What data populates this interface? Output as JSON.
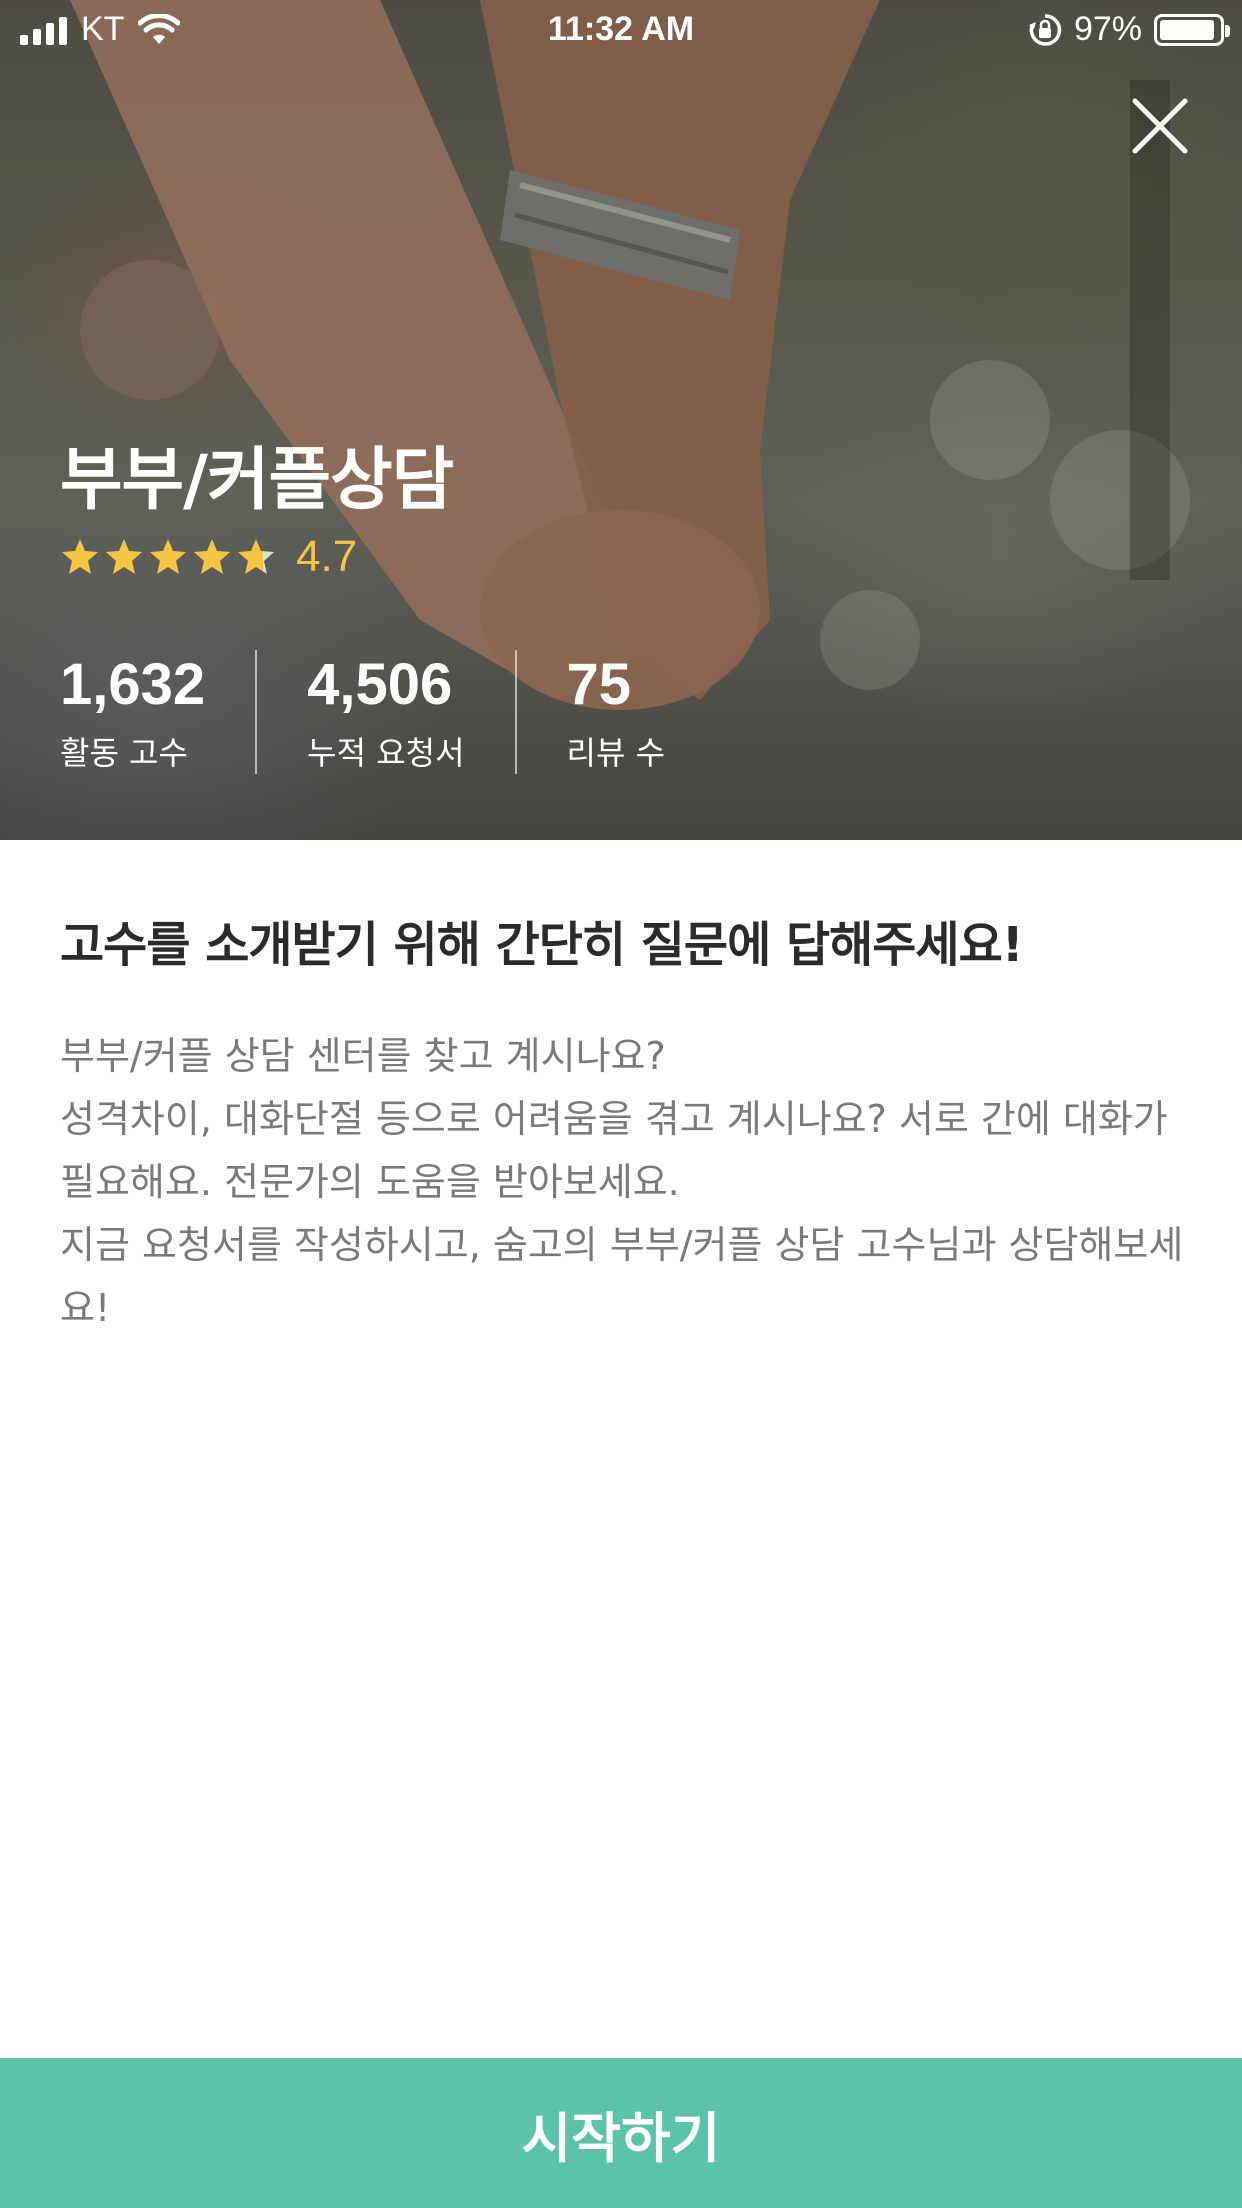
{
  "status_bar": {
    "carrier": "KT",
    "time": "11:32 AM",
    "battery": "97%"
  },
  "hero": {
    "title": "부부/커플상담",
    "rating": "4.7",
    "rating_value": 4.7,
    "stats": [
      {
        "value": "1,632",
        "label": "활동 고수"
      },
      {
        "value": "4,506",
        "label": "누적 요청서"
      },
      {
        "value": "75",
        "label": "리뷰 수"
      }
    ]
  },
  "content": {
    "heading": "고수를 소개받기 위해 간단히 질문에 답해주세요!",
    "lines": [
      "부부/커플 상담 센터를 찾고 계시나요?",
      "성격차이, 대화단절 등으로 어려움을 겪고 계시나요? 서로 간에 대화가 필요해요. 전문가의 도움을 받아보세요.",
      "지금 요청서를 작성하시고, 숨고의 부부/커플 상담 고수님과 상담해보세요!"
    ]
  },
  "cta": {
    "label": "시작하기"
  },
  "colors": {
    "accent": "#5bc3aa",
    "star": "#f5c443",
    "heading_text": "#2b2b2b",
    "body_text": "#7a7a7a"
  },
  "icons": {
    "close": "close-icon",
    "star": "star-icon",
    "wifi": "wifi-icon",
    "signal": "signal-icon",
    "orientation_lock": "orientation-lock-icon",
    "battery": "battery-icon"
  }
}
